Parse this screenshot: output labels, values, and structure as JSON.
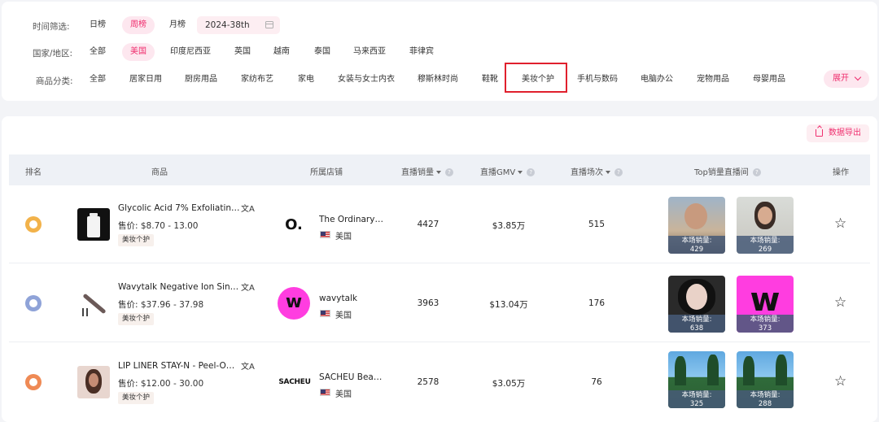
{
  "filters": {
    "time": {
      "label": "时间筛选:",
      "options": [
        "日榜",
        "周榜",
        "月榜"
      ],
      "selected": "周榜",
      "week_value": "2024-38th"
    },
    "region": {
      "label": "国家/地区:",
      "options": [
        "全部",
        "美国",
        "印度尼西亚",
        "英国",
        "越南",
        "泰国",
        "马来西亚",
        "菲律宾"
      ],
      "selected": "美国"
    },
    "category": {
      "label": "商品分类:",
      "options": [
        "全部",
        "居家日用",
        "厨房用品",
        "家纺布艺",
        "家电",
        "女装与女士内衣",
        "穆斯林时尚",
        "鞋靴",
        "美妆个护",
        "手机与数码",
        "电脑办公",
        "宠物用品",
        "母婴用品"
      ],
      "selected": "美妆个护",
      "expand_label": "展开"
    }
  },
  "toolbar": {
    "export_label": "数据导出"
  },
  "table": {
    "headers": {
      "rank": "排名",
      "product": "商品",
      "shop": "所属店铺",
      "live_sales": "直播销量",
      "live_gmv": "直播GMV",
      "live_sessions": "直播场次",
      "top_rooms": "Top销量直播间",
      "actions": "操作"
    },
    "rows": [
      {
        "title": "Glycolic Acid 7% Exfoliating To···",
        "price": "售价: $8.70 - 13.00",
        "tag": "美妆个护",
        "shop": "The Ordinary S···",
        "shop_logo_text": "O.",
        "country": "美国",
        "sales": "4427",
        "gmv": "$3.85万",
        "sessions": "515",
        "rooms": [
          {
            "caption": "本场销量:",
            "value": "429"
          },
          {
            "caption": "本场销量:",
            "value": "269"
          }
        ]
      },
      {
        "title": "Wavytalk Negative Ion Single ···",
        "price": "售价: $37.96 - 37.98",
        "tag": "美妆个护",
        "shop": "wavytalk",
        "shop_logo_text": "w",
        "country": "美国",
        "sales": "3963",
        "gmv": "$13.04万",
        "sessions": "176",
        "rooms": [
          {
            "caption": "本场销量:",
            "value": "638"
          },
          {
            "caption": "本场销量:",
            "value": "373",
            "logo_text": "w"
          }
        ]
      },
      {
        "title": "LIP LINER STAY-N - Peel-Off Lip···",
        "price": "售价: $12.00 - 30.00",
        "tag": "美妆个护",
        "shop": "SACHEU Beauty",
        "shop_logo_text": "SACHEU",
        "country": "美国",
        "sales": "2578",
        "gmv": "$3.05万",
        "sessions": "76",
        "rooms": [
          {
            "caption": "本场销量:",
            "value": "325"
          },
          {
            "caption": "本场销量:",
            "value": "288"
          }
        ]
      }
    ]
  },
  "colors": {
    "accent": "#ef2d6d",
    "accent_bg": "#fde7ef",
    "highlight_border": "#e0202d",
    "rank_gold": "#f2b24a",
    "rank_silver": "#8fa3d8",
    "rank_bronze": "#ef8a55",
    "wavytalk_pink": "#ff3de0"
  }
}
